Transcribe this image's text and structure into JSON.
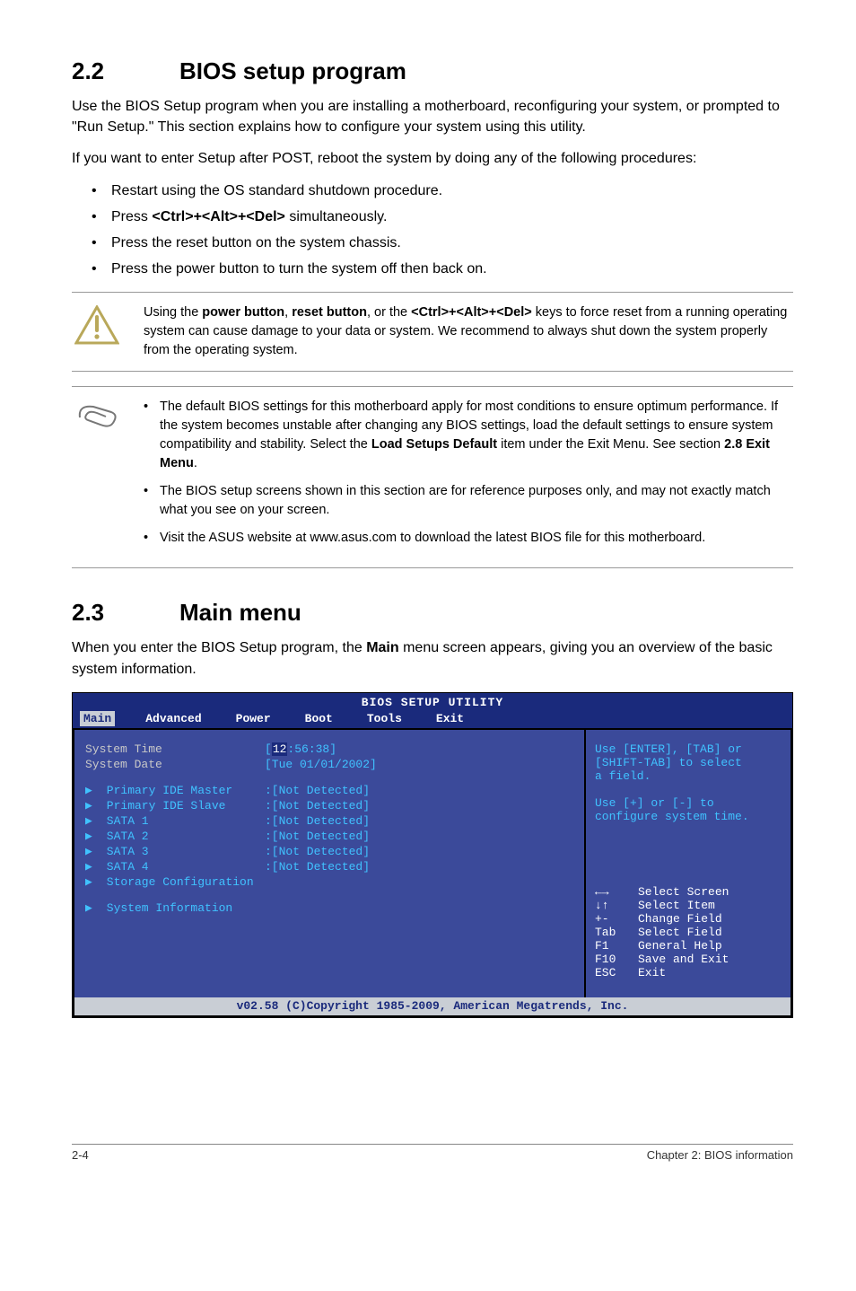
{
  "section22": {
    "num": "2.2",
    "title": "BIOS setup program",
    "p1": "Use the BIOS Setup program when you are installing a motherboard, reconfiguring your system, or prompted to \"Run Setup.\" This section explains how to configure your system using this utility.",
    "p2": "If you want to enter Setup after POST, reboot the system by doing any of the following procedures:",
    "bullets": [
      "Restart using the OS standard shutdown procedure.",
      "Press <Ctrl>+<Alt>+<Del> simultaneously.",
      "Press the reset button on the system chassis.",
      "Press the power button to turn the system off then back on."
    ],
    "bullet2_pre": "Press ",
    "bullet2_bold": "<Ctrl>+<Alt>+<Del>",
    "bullet2_post": " simultaneously."
  },
  "warn": {
    "pre": "Using the ",
    "b1": "power button",
    "mid1": ", ",
    "b2": "reset button",
    "mid2": ", or the ",
    "b3": "<Ctrl>+<Alt>+<Del>",
    "post": " keys to force reset from a running operating system can cause damage to your data or system. We recommend to always shut down the system properly from the operating system."
  },
  "note": {
    "li1_pre": "The default BIOS settings for this motherboard apply for most conditions to ensure optimum performance. If the system becomes unstable after changing any BIOS settings, load the default settings to ensure system compatibility and stability. Select the ",
    "li1_b1": "Load Setups Default",
    "li1_mid": " item under the Exit Menu. See section ",
    "li1_b2": "2.8 Exit Menu",
    "li1_post": ".",
    "li2": "The BIOS setup screens shown in this section are for reference purposes only, and may not exactly match what you see on your screen.",
    "li3": "Visit the ASUS website at www.asus.com to download the latest BIOS file for this motherboard."
  },
  "section23": {
    "num": "2.3",
    "title": "Main menu",
    "p1_pre": "When you enter the BIOS Setup program, the ",
    "p1_bold": "Main",
    "p1_post": " menu screen appears, giving you an overview of the basic system information."
  },
  "bios": {
    "title": "BIOS SETUP UTILITY",
    "tabs": [
      "Main",
      "Advanced",
      "Power",
      "Boot",
      "Tools",
      "Exit"
    ],
    "active_tab_index": 0,
    "rows_top": [
      {
        "label": "System Time",
        "value_pre": "[",
        "value_hl": "12",
        "value_post": ":56:38]"
      },
      {
        "label": "System Date",
        "value": "[Tue 01/01/2002]"
      }
    ],
    "rows_sub": [
      {
        "label": "Primary IDE Master",
        "value": ":[Not Detected]"
      },
      {
        "label": "Primary IDE Slave",
        "value": ":[Not Detected]"
      },
      {
        "label": "SATA 1",
        "value": ":[Not Detected]"
      },
      {
        "label": "SATA 2",
        "value": ":[Not Detected]"
      },
      {
        "label": "SATA 3",
        "value": ":[Not Detected]"
      },
      {
        "label": "SATA 4",
        "value": ":[Not Detected]"
      },
      {
        "label": "Storage Configuration",
        "value": ""
      }
    ],
    "rows_bottom": [
      {
        "label": "System Information",
        "value": ""
      }
    ],
    "help_top": "Use [ENTER], [TAB] or\n[SHIFT-TAB] to select\na field.\n\nUse [+] or [-] to\nconfigure system time.",
    "keys": [
      {
        "k": "←→",
        "d": "Select Screen"
      },
      {
        "k": "↓↑",
        "d": "Select Item"
      },
      {
        "k": "+-",
        "d": "Change Field"
      },
      {
        "k": "Tab",
        "d": "Select Field"
      },
      {
        "k": "F1",
        "d": "General Help"
      },
      {
        "k": "F10",
        "d": "Save and Exit"
      },
      {
        "k": "ESC",
        "d": "Exit"
      }
    ],
    "footer": "v02.58 (C)Copyright 1985-2009, American Megatrends, Inc."
  },
  "footer": {
    "left": "2-4",
    "right": "Chapter 2: BIOS information"
  },
  "icons": {
    "warn": "warning-triangle-icon",
    "note": "paperclip-note-icon",
    "arrow": "right-triangle-icon"
  }
}
